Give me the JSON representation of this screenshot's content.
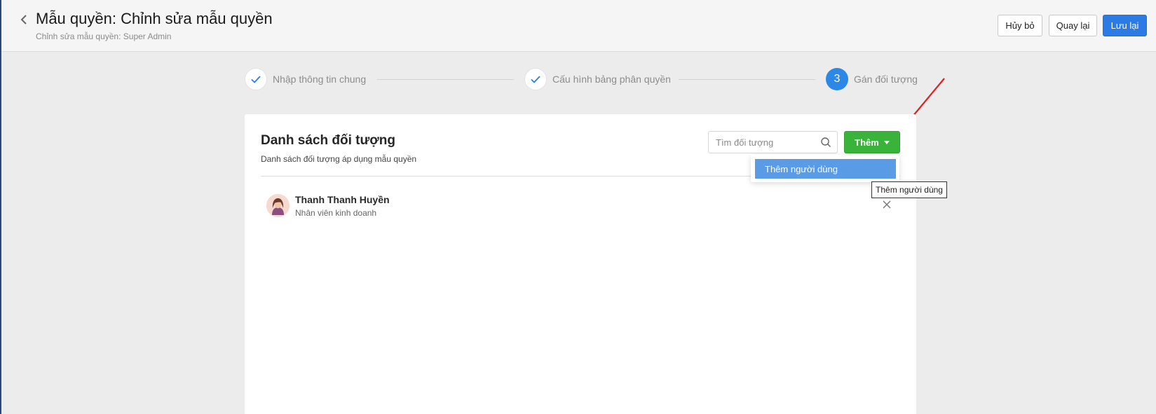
{
  "header": {
    "title": "Mẫu quyền: Chỉnh sửa mẫu quyền",
    "subtitle": "Chỉnh sửa mẫu quyền: Super Admin",
    "buttons": {
      "cancel": "Hủy bỏ",
      "back": "Quay lại",
      "save": "Lưu lại"
    }
  },
  "stepper": {
    "steps": [
      {
        "label": "Nhập thông tin chung",
        "status": "done"
      },
      {
        "label": "Cấu hình bảng phân quyền",
        "status": "done"
      },
      {
        "label": "Gán đối tượng",
        "status": "active",
        "number": "3"
      }
    ]
  },
  "card": {
    "title": "Danh sách đối tượng",
    "subtitle": "Danh sách đối tượng áp dụng mẫu quyền",
    "search_placeholder": "Tìm đối tượng",
    "add_button": "Thêm",
    "dropdown_item": "Thêm người dùng",
    "tooltip": "Thêm người dùng",
    "users": [
      {
        "name": "Thanh Thanh Huyền",
        "role": "Nhân viên kinh doanh"
      }
    ]
  },
  "colors": {
    "primary": "#2c7be5",
    "success": "#3ab33a",
    "step_active": "#2c88e6",
    "dropdown_highlight": "#5a9be6",
    "annotation_arrow": "#e02020"
  }
}
